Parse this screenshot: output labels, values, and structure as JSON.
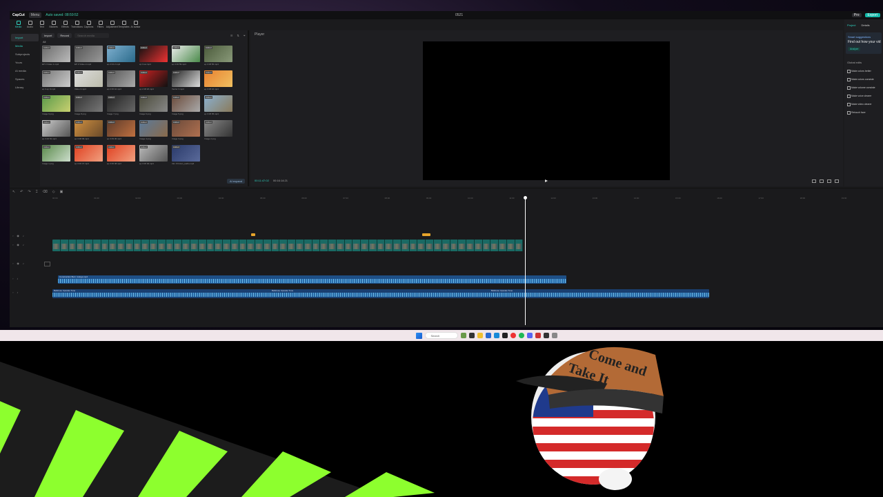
{
  "menubar": {
    "brand": "CapCut",
    "menu": "Menu",
    "autosave": "Auto saved: 08:59:52",
    "project_title": "0521",
    "pro": "Pro",
    "export": "Export"
  },
  "toolbar": {
    "tools": [
      "Media",
      "Audio",
      "Text",
      "Stickers",
      "Effects",
      "Transitions",
      "Captions",
      "Filters",
      "Adjustment",
      "Templates",
      "AI avatar"
    ]
  },
  "sidenav": {
    "items": [
      "Import",
      "Media",
      "Subprojects",
      "Yours",
      "AI media",
      "Spaces",
      "Library"
    ]
  },
  "mediabar": {
    "import": "Import",
    "record": "Record",
    "search_placeholder": "Search media",
    "all": "All"
  },
  "media": {
    "badge": "Added",
    "items": [
      {
        "cap": "EP 3 Video 1.mp4",
        "c1": "#6a6a6a",
        "c2": "#bbb"
      },
      {
        "cap": "EP 3 Video 2.mp4",
        "c1": "#555",
        "c2": "#999"
      },
      {
        "cap": "ep 2 04 2 mp4",
        "c1": "#7fb0d0",
        "c2": "#2a6a8a"
      },
      {
        "cap": "ep 3 ea.mp4",
        "c1": "#111",
        "c2": "#e33"
      },
      {
        "cap": "ep 3 06 59.mp4",
        "c1": "#eee",
        "c2": "#4a8a4a"
      },
      {
        "cap": "ep 3 08 56.mp4",
        "c1": "#4a5a3a",
        "c2": "#8a9a7a"
      },
      {
        "cap": "ep 3 ep 9.mp4",
        "c1": "#777",
        "c2": "#ccc"
      },
      {
        "cap": "Video 3.mp4",
        "c1": "#ddd",
        "c2": "#bba"
      },
      {
        "cap": "ep 2 06 10.mp4",
        "c1": "#555",
        "c2": "#aaa"
      },
      {
        "cap": "ep 2 08 20.mp4",
        "c1": "#c22",
        "c2": "#111"
      },
      {
        "cap": "Vector 3.mp4",
        "c1": "#222",
        "c2": "#ddd"
      },
      {
        "cap": "ep 3 08 16.mp4",
        "c1": "#e88030",
        "c2": "#f0c060"
      },
      {
        "cap": "Image 9.png",
        "c1": "#5a9a4a",
        "c2": "#c9d070"
      },
      {
        "cap": "Image 8.png",
        "c1": "#333",
        "c2": "#777"
      },
      {
        "cap": "Image 7.png",
        "c1": "#222",
        "c2": "#666"
      },
      {
        "cap": "Image 6.png",
        "c1": "#4a4a3a",
        "c2": "#888"
      },
      {
        "cap": "Image 5.png",
        "c1": "#6a4a3a",
        "c2": "#aaa"
      },
      {
        "cap": "ep 3 08 05.mp4",
        "c1": "#8ab0d0",
        "c2": "#8a7a5a"
      },
      {
        "cap": "ep 3 06 52.mp4",
        "c1": "#ccc",
        "c2": "#555"
      },
      {
        "cap": "ep 3 08 09.mp4",
        "c1": "#d09040",
        "c2": "#6a4a2a"
      },
      {
        "cap": "ep 3 09 36.mp4",
        "c1": "#5a3a2a",
        "c2": "#c07040"
      },
      {
        "cap": "Image 4.png",
        "c1": "#5a7a9a",
        "c2": "#8a6a4a"
      },
      {
        "cap": "Image 3.png",
        "c1": "#6a4a3a",
        "c2": "#b07050"
      },
      {
        "cap": "Image 2.png",
        "c1": "#888",
        "c2": "#333"
      },
      {
        "cap": "Image 1.png",
        "c1": "#5a8a4a",
        "c2": "#cdc"
      },
      {
        "cap": "ep 3 06 47.mp4",
        "c1": "#e04020",
        "c2": "#f0a080"
      },
      {
        "cap": "ep 3 06 48.mp4",
        "c1": "#e04020",
        "c2": "#f0a080"
      },
      {
        "cap": "ep 3 06 02.mp4",
        "c1": "#bbb",
        "c2": "#555"
      },
      {
        "cap": "trim 0 brown_audio.mp4",
        "c1": "#2a3a6a",
        "c2": "#5a6a9a"
      }
    ],
    "ai_expand": "AI expand"
  },
  "player": {
    "label": "Player",
    "current": "00:11:47:02",
    "duration": "00:16:14:21"
  },
  "rightpanel": {
    "tabs": [
      "Project",
      "Details"
    ],
    "smart_title": "Smart suggestions",
    "smart_sub": "Find out how your vid",
    "analyze": "Analyze",
    "global_title": "Global edits",
    "items": [
      "Make colors better",
      "Make colors consiste",
      "Make volume consiste",
      "Make voice clearer",
      "Make video clearer",
      "Retouch face"
    ]
  },
  "timeline": {
    "ruler": [
      "00:00",
      "01:00",
      "02:00",
      "03:00",
      "04:00",
      "05:00",
      "06:00",
      "07:00",
      "08:00",
      "09:00",
      "10:00",
      "11:00",
      "12:00",
      "13:00",
      "14:00",
      "15:00",
      "16:00",
      "17:00",
      "18:00",
      "19:00"
    ],
    "cover": "Cover",
    "audio1_label": "Construction Burn mxlogs.mp4",
    "audio2_labels": [
      "Bellicose Upscale Tune",
      "Bellicose Upscale Tune",
      "Bellicose Upscale Tune"
    ],
    "playhead_fraction": 0.725
  },
  "taskbar": {
    "search": "Search"
  },
  "scene": {
    "hat_text": [
      "Come and",
      "Take It"
    ],
    "stripe_color": "#8dff2e",
    "flag_red": "#d42a2a",
    "flag_blue": "#1f3a8c"
  }
}
